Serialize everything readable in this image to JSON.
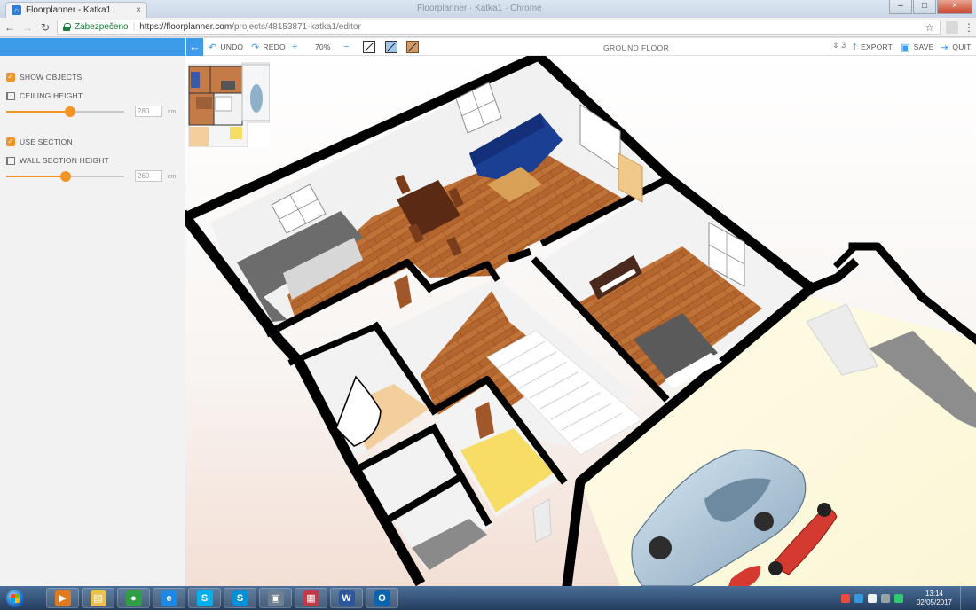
{
  "browser": {
    "tab_title": "Floorplanner - Katka1",
    "tab_close": "×",
    "window_title": "Floorplanner · Katka1 · Chrome",
    "secure_label": "Zabezpečeno",
    "url_host": "https://floorplanner.com",
    "url_path": "/projects/48153871-katka1/editor",
    "nav": {
      "back": "←",
      "forward": "→",
      "reload": "↻"
    },
    "window_controls": {
      "minimize": "–",
      "maximize": "□",
      "close": "×"
    }
  },
  "toolbar": {
    "back_glyph": "←",
    "undo_label": "UNDO",
    "redo_label": "REDO",
    "zoom_in": "+",
    "zoom_level": "70%",
    "zoom_out": "−",
    "floor_name": "GROUND FLOOR",
    "floor_count": "3",
    "export_label": "EXPORT",
    "save_label": "SAVE",
    "quit_label": "QUIT"
  },
  "sidebar": {
    "show_objects": {
      "label": "SHOW OBJECTS",
      "checked": true
    },
    "ceiling_height": {
      "label": "CEILING HEIGHT",
      "value": "280",
      "unit": "cm",
      "slider_fraction": 0.54
    },
    "use_section": {
      "label": "USE SECTION",
      "checked": true
    },
    "wall_section_height": {
      "label": "WALL SECTION HEIGHT",
      "value": "260",
      "unit": "cm",
      "slider_fraction": 0.5
    }
  },
  "taskbar": {
    "apps": [
      {
        "name": "media-player",
        "glyph": "▶",
        "color": "#e07a1f"
      },
      {
        "name": "file-explorer",
        "glyph": "▤",
        "color": "#e8c24a"
      },
      {
        "name": "chrome",
        "glyph": "●",
        "color": "#2f9e44"
      },
      {
        "name": "internet-explorer",
        "glyph": "e",
        "color": "#1e88e5"
      },
      {
        "name": "skype",
        "glyph": "S",
        "color": "#00aff0"
      },
      {
        "name": "skype-2",
        "glyph": "S",
        "color": "#0090d6"
      },
      {
        "name": "image-viewer",
        "glyph": "▣",
        "color": "#6d7f93"
      },
      {
        "name": "floppy",
        "glyph": "▦",
        "color": "#c03a4a"
      },
      {
        "name": "word",
        "glyph": "W",
        "color": "#2b579a"
      },
      {
        "name": "outlook",
        "glyph": "O",
        "color": "#0a64ad"
      }
    ],
    "time": "13:14",
    "date": "02/05/2017"
  },
  "colors": {
    "accent_blue": "#3d9be9",
    "accent_orange": "#f39425",
    "wood_floor": "#b3622c",
    "tile_floor": "#f4cf9e",
    "yellow_floor": "#f7dd66"
  }
}
